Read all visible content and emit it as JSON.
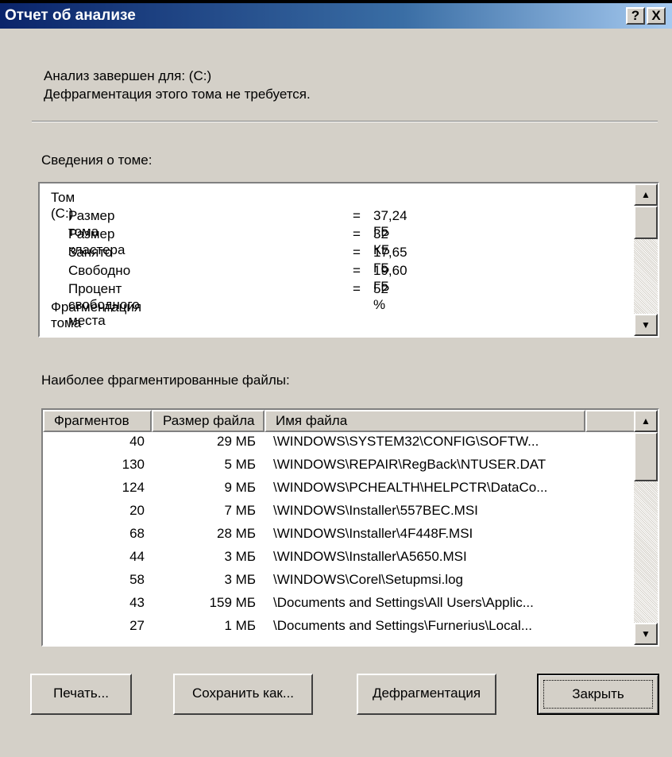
{
  "window": {
    "title": "Отчет об анализе",
    "help_btn": "?",
    "close_btn": "X"
  },
  "status": {
    "line1": "Анализ завершен для: (C:)",
    "line2": "Дефрагментация этого тома не требуется."
  },
  "volume_info": {
    "label": "Сведения о томе:",
    "rows": [
      {
        "key": "Том (C:)",
        "eq": "",
        "val": ""
      },
      {
        "key": "Размер тома",
        "eq": "=",
        "val": "37,24 ГБ"
      },
      {
        "key": "Размер кластера",
        "eq": "=",
        "val": "32 КБ"
      },
      {
        "key": "Занято",
        "eq": "=",
        "val": "17,65 ГБ"
      },
      {
        "key": "Свободно",
        "eq": "=",
        "val": "19,60 ГБ"
      },
      {
        "key": "Процент свободного места",
        "eq": "=",
        "val": "52 %"
      },
      {
        "key": "Фрагментация тома",
        "eq": "",
        "val": ""
      }
    ]
  },
  "files": {
    "label": "Наиболее фрагментированные файлы:",
    "columns": [
      "Фрагментов",
      "Размер файла",
      "Имя файла"
    ],
    "rows": [
      {
        "frag": "40",
        "size": "29 МБ",
        "name": "\\WINDOWS\\SYSTEM32\\CONFIG\\SOFTW..."
      },
      {
        "frag": "130",
        "size": "5 МБ",
        "name": "\\WINDOWS\\REPAIR\\RegBack\\NTUSER.DAT"
      },
      {
        "frag": "124",
        "size": "9 МБ",
        "name": "\\WINDOWS\\PCHEALTH\\HELPCTR\\DataCo..."
      },
      {
        "frag": "20",
        "size": "7 МБ",
        "name": "\\WINDOWS\\Installer\\557BEC.MSI"
      },
      {
        "frag": "68",
        "size": "28 МБ",
        "name": "\\WINDOWS\\Installer\\4F448F.MSI"
      },
      {
        "frag": "44",
        "size": "3 МБ",
        "name": "\\WINDOWS\\Installer\\A5650.MSI"
      },
      {
        "frag": "58",
        "size": "3 МБ",
        "name": "\\WINDOWS\\Corel\\Setupmsi.log"
      },
      {
        "frag": "43",
        "size": "159 МБ",
        "name": "\\Documents and Settings\\All Users\\Applic..."
      },
      {
        "frag": "27",
        "size": "1 МБ",
        "name": "\\Documents and Settings\\Furnerius\\Local..."
      }
    ]
  },
  "buttons": {
    "print": "Печать...",
    "save_as": "Сохранить как...",
    "defrag": "Дефрагментация",
    "close": "Закрыть"
  },
  "scroll_arrows": {
    "up": "▲",
    "down": "▼"
  }
}
